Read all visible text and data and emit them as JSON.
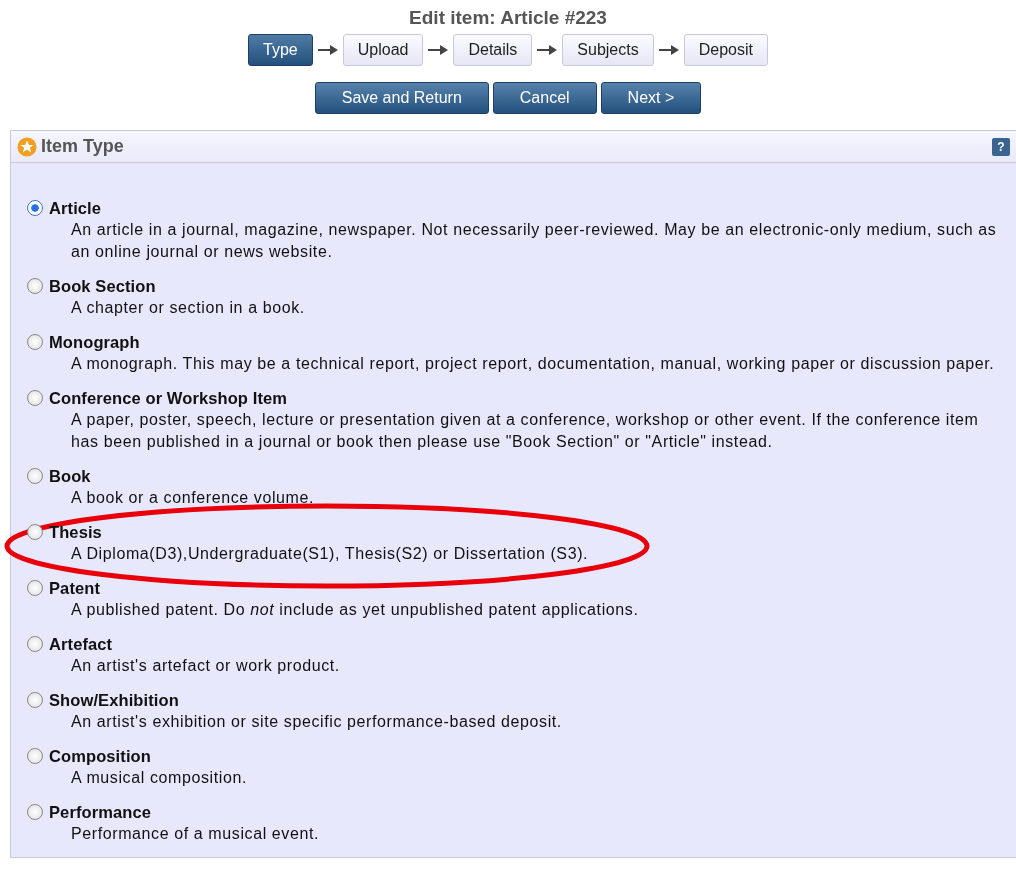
{
  "title": "Edit item: Article #223",
  "steps": [
    {
      "label": "Type",
      "selected": true
    },
    {
      "label": "Upload",
      "selected": false
    },
    {
      "label": "Details",
      "selected": false
    },
    {
      "label": "Subjects",
      "selected": false
    },
    {
      "label": "Deposit",
      "selected": false
    }
  ],
  "buttons": [
    "Save and Return",
    "Cancel",
    "Next >"
  ],
  "panel": {
    "title": "Item Type",
    "help": "?",
    "items": [
      {
        "label": "Article",
        "description": "An article in a journal, magazine, newspaper. Not necessarily peer-reviewed. May be an electronic-only medium, such as an online journal or news website.",
        "selected": true,
        "circled": false
      },
      {
        "label": "Book Section",
        "description": "A chapter or section in a book.",
        "selected": false,
        "circled": false
      },
      {
        "label": "Monograph",
        "description": "A monograph. This may be a technical report, project report, documentation, manual, working paper or discussion paper.",
        "selected": false,
        "circled": false
      },
      {
        "label": "Conference or Workshop Item",
        "description": "A paper, poster, speech, lecture or presentation given at a conference, workshop or other event. If the conference item has been published in a journal or book then please use \"Book Section\" or \"Article\" instead.",
        "selected": false,
        "circled": false
      },
      {
        "label": "Book",
        "description": "A book or a conference volume.",
        "selected": false,
        "circled": false
      },
      {
        "label": "Thesis",
        "description": "A Diploma(D3),Undergraduate(S1), Thesis(S2) or Dissertation (S3).",
        "selected": false,
        "circled": true
      },
      {
        "label": "Patent",
        "description": "A published patent. Do *not* include as yet unpublished patent applications.",
        "selected": false,
        "circled": false
      },
      {
        "label": "Artefact",
        "description": "An artist's artefact or work product.",
        "selected": false,
        "circled": false
      },
      {
        "label": "Show/Exhibition",
        "description": "An artist's exhibition or site specific performance-based deposit.",
        "selected": false,
        "circled": false
      },
      {
        "label": "Composition",
        "description": "A musical composition.",
        "selected": false,
        "circled": false
      },
      {
        "label": "Performance",
        "description": "Performance of a musical event.",
        "selected": false,
        "circled": false
      }
    ]
  }
}
